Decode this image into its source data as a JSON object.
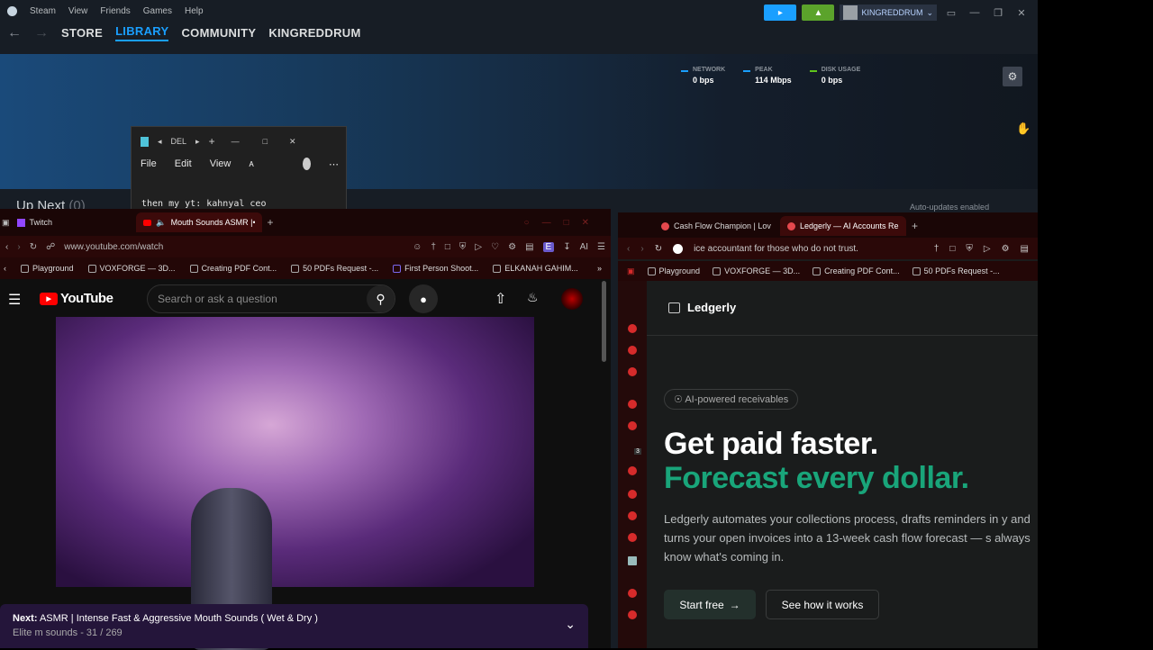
{
  "steam": {
    "menu": [
      "Steam",
      "View",
      "Friends",
      "Games",
      "Help"
    ],
    "tabs": [
      "STORE",
      "LIBRARY",
      "COMMUNITY",
      "KINGREDDRUM"
    ],
    "username": "KINGREDDRUM",
    "stats": [
      {
        "label": "NETWORK",
        "value": "0 bps",
        "color": "#1a9fff"
      },
      {
        "label": "PEAK",
        "value": "114 Mbps",
        "color": "#1a9fff"
      },
      {
        "label": "DISK USAGE",
        "value": "0 bps",
        "color": "#5fc51c"
      }
    ],
    "up_next": "Up Next",
    "up_next_count": "(0)",
    "auto_updates": "Auto-updates enabled"
  },
  "notepad": {
    "tab_title": "DEL",
    "menu": [
      "File",
      "Edit",
      "View"
    ],
    "text": "then my yt: kahnyal ceo"
  },
  "left_browser": {
    "tabs": [
      "Twitch",
      "Mouth Sounds ASMR |•"
    ],
    "url": "www.youtube.com/watch",
    "ai_label": "AI",
    "bookmarks": [
      "Playground",
      "VOXFORGE — 3D...",
      "Creating PDF Cont...",
      "50 PDFs Request -...",
      "First Person Shoot...",
      "ELKANAH GAHIM..."
    ],
    "youtube": {
      "logo_text": "YouTube",
      "search_placeholder": "Search or ask a question",
      "next_label": "Next:",
      "next_title": "ASMR | Intense Fast & Aggressive Mouth Sounds ( Wet & Dry )",
      "next_sub": "Elite m sounds - 31 / 269"
    }
  },
  "right_browser": {
    "tabs": [
      "Cash Flow Champion | Lov",
      "Ledgerly — AI Accounts Re"
    ],
    "url": "ice accountant for those who do not trust.",
    "bookmarks": [
      "Playground",
      "VOXFORGE — 3D...",
      "Creating PDF Cont...",
      "50 PDFs Request -..."
    ],
    "sidebar_badge": "3",
    "ledgerly": {
      "brand": "Ledgerly",
      "pill": "AI-powered receivables",
      "headline1": "Get paid faster.",
      "headline2": "Forecast every dollar.",
      "paragraph": "Ledgerly automates your collections process, drafts reminders in y and turns your open invoices into a 13-week cash flow forecast — s always know what's coming in.",
      "cta_primary": "Start free",
      "cta_secondary": "See how it works",
      "accent": "#19a57a"
    }
  }
}
